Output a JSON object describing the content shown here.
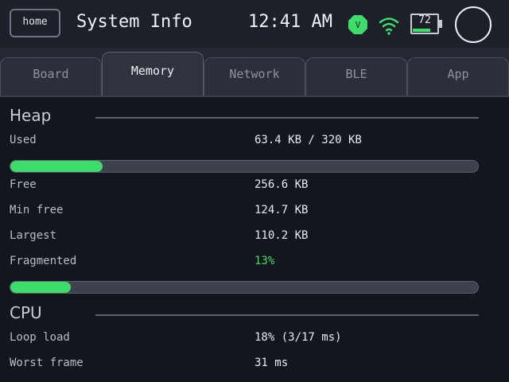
{
  "header": {
    "home_label": "home",
    "title": "System Info",
    "time": "12:41 AM",
    "badge_letter": "V",
    "battery_level": "72",
    "battery_fraction": 0.72,
    "accent_color": "#3ddc6b"
  },
  "tabs": [
    {
      "label": "Board",
      "active": false
    },
    {
      "label": "Memory",
      "active": true
    },
    {
      "label": "Network",
      "active": false
    },
    {
      "label": "BLE",
      "active": false
    },
    {
      "label": "App",
      "active": false
    }
  ],
  "heap": {
    "title": "Heap",
    "used_label": "Used",
    "used_value": "63.4 KB / 320 KB",
    "used_fraction": 0.198,
    "free_label": "Free",
    "free_value": "256.6 KB",
    "min_free_label": "Min free",
    "min_free_value": "124.7 KB",
    "largest_label": "Largest",
    "largest_value": "110.2 KB",
    "fragmented_label": "Fragmented",
    "fragmented_value": "13%",
    "fragmented_fraction": 0.13
  },
  "cpu": {
    "title": "CPU",
    "loop_load_label": "Loop load",
    "loop_load_value": "18% (3/17 ms)",
    "worst_frame_label": "Worst frame",
    "worst_frame_value": "31 ms"
  }
}
